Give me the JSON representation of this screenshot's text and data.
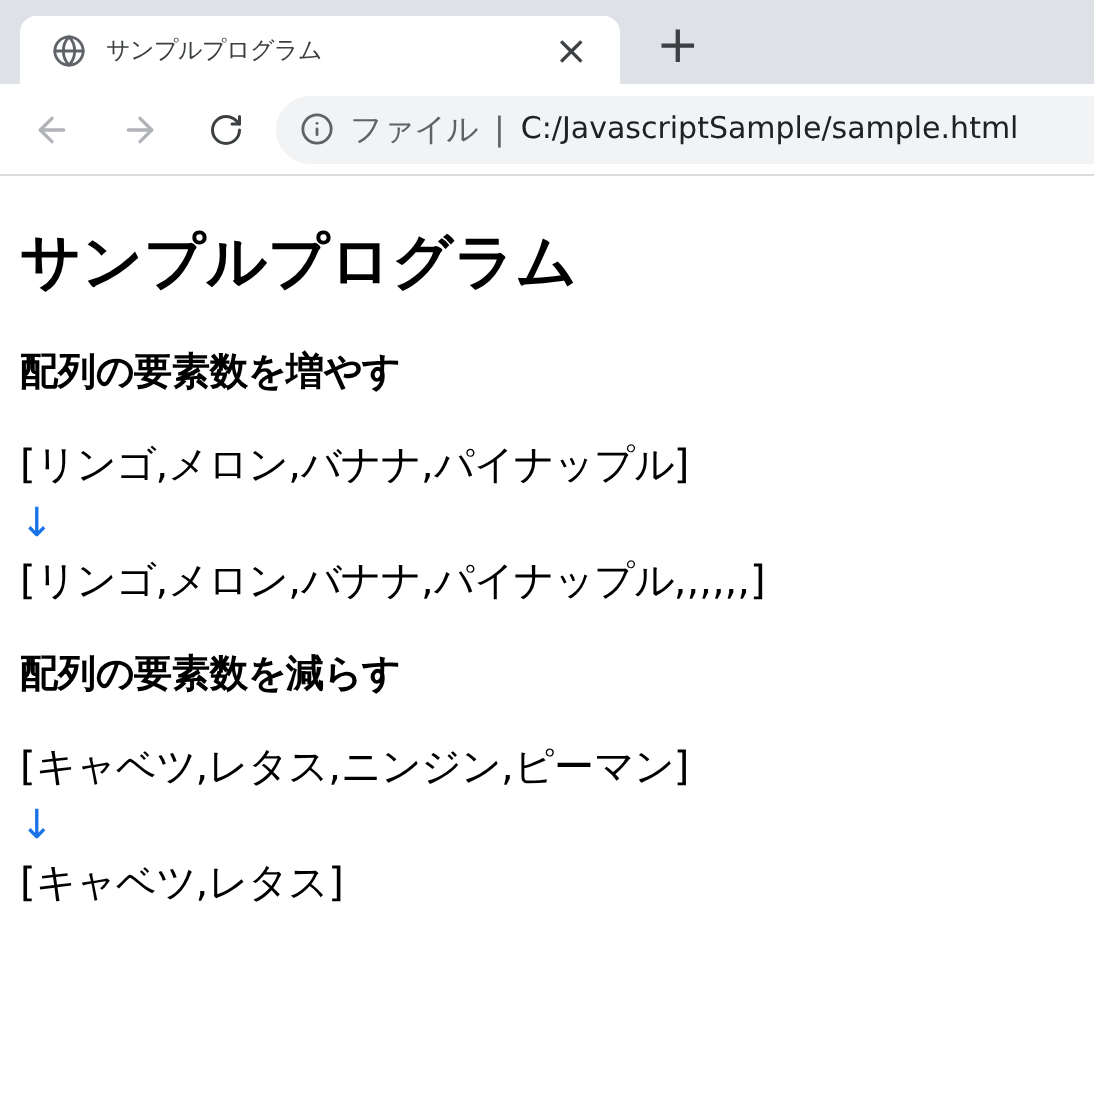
{
  "tab": {
    "title": "サンプルプログラム",
    "close": "×",
    "new_tab": "+"
  },
  "address_bar": {
    "scheme_label": "ファイル",
    "separator": "|",
    "url": "C:/JavascriptSample/sample.html"
  },
  "page": {
    "title": "サンプルプログラム",
    "sections": [
      {
        "heading": "配列の要素数を増やす",
        "lines": [
          {
            "kind": "text",
            "text": "[リンゴ,メロン,バナナ,パイナップル]"
          },
          {
            "kind": "arrow",
            "text": "↓"
          },
          {
            "kind": "text",
            "text": "[リンゴ,メロン,バナナ,パイナップル,,,,,,]"
          }
        ]
      },
      {
        "heading": "配列の要素数を減らす",
        "lines": [
          {
            "kind": "text",
            "text": "[キャベツ,レタス,ニンジン,ピーマン]"
          },
          {
            "kind": "arrow",
            "text": "↓"
          },
          {
            "kind": "text",
            "text": "[キャベツ,レタス]"
          }
        ]
      }
    ]
  }
}
